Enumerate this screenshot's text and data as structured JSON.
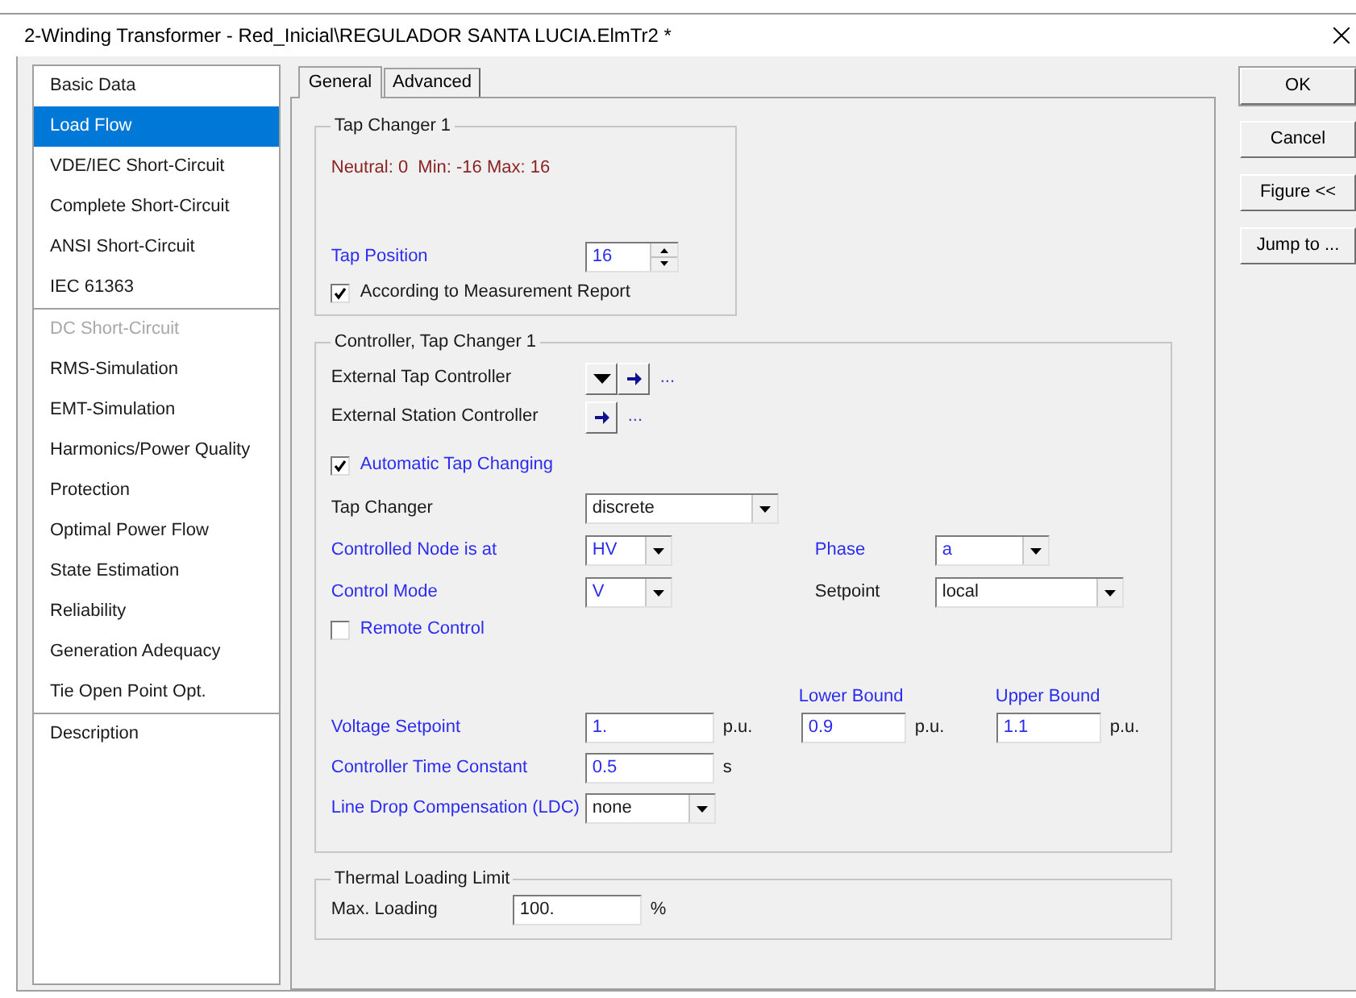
{
  "window": {
    "title": "2-Winding Transformer - Red_Inicial\\REGULADOR SANTA LUCIA.ElmTr2 *"
  },
  "sidebar": {
    "groups": [
      {
        "items": [
          {
            "label": "Basic Data",
            "selected": false,
            "disabled": false
          },
          {
            "label": "Load Flow",
            "selected": true,
            "disabled": false
          },
          {
            "label": "VDE/IEC Short-Circuit",
            "selected": false,
            "disabled": false
          },
          {
            "label": "Complete Short-Circuit",
            "selected": false,
            "disabled": false
          },
          {
            "label": "ANSI Short-Circuit",
            "selected": false,
            "disabled": false
          },
          {
            "label": "IEC 61363",
            "selected": false,
            "disabled": false
          }
        ]
      },
      {
        "items": [
          {
            "label": "DC Short-Circuit",
            "selected": false,
            "disabled": true
          },
          {
            "label": "RMS-Simulation",
            "selected": false,
            "disabled": false
          },
          {
            "label": "EMT-Simulation",
            "selected": false,
            "disabled": false
          },
          {
            "label": "Harmonics/Power Quality",
            "selected": false,
            "disabled": false
          },
          {
            "label": "Protection",
            "selected": false,
            "disabled": false
          },
          {
            "label": "Optimal Power Flow",
            "selected": false,
            "disabled": false
          },
          {
            "label": "State Estimation",
            "selected": false,
            "disabled": false
          },
          {
            "label": "Reliability",
            "selected": false,
            "disabled": false
          },
          {
            "label": "Generation Adequacy",
            "selected": false,
            "disabled": false
          },
          {
            "label": "Tie Open Point Opt.",
            "selected": false,
            "disabled": false
          }
        ]
      },
      {
        "items": [
          {
            "label": "Description",
            "selected": false,
            "disabled": false
          }
        ]
      }
    ]
  },
  "tabs": [
    {
      "label": "General",
      "selected": true
    },
    {
      "label": "Advanced",
      "selected": false
    }
  ],
  "tap_changer": {
    "title": "Tap Changer 1",
    "range_info": "Neutral: 0  Min: -16 Max: 16",
    "tap_position": {
      "label": "Tap Position",
      "value": "16",
      "highlighted": true,
      "value_highlighted": true
    },
    "measurement_report": {
      "label": "According to Measurement Report",
      "checked": true,
      "highlighted": false
    }
  },
  "controller": {
    "title": "Controller, Tap Changer 1",
    "external_tap_controller": {
      "label": "External Tap Controller",
      "link": "..."
    },
    "external_station_controller": {
      "label": "External Station Controller",
      "link": "..."
    },
    "automatic_tap_changing": {
      "label": "Automatic Tap Changing",
      "checked": true,
      "highlighted": true
    },
    "tap_changer": {
      "label": "Tap Changer",
      "value": "discrete",
      "highlighted": false,
      "value_highlighted": false
    },
    "controlled_node": {
      "label": "Controlled Node is at",
      "value": "HV",
      "highlighted": true,
      "value_highlighted": true
    },
    "phase": {
      "label": "Phase",
      "value": "a",
      "highlighted": true,
      "value_highlighted": true
    },
    "control_mode": {
      "label": "Control Mode",
      "value": "V",
      "highlighted": true,
      "value_highlighted": true
    },
    "setpoint": {
      "label": "Setpoint",
      "value": "local",
      "highlighted": false,
      "value_highlighted": false
    },
    "remote_control": {
      "label": "Remote Control",
      "checked": false,
      "highlighted": true
    },
    "voltage_setpoint": {
      "label": "Voltage Setpoint",
      "value": "1.",
      "unit": "p.u.",
      "highlighted": true,
      "value_highlighted": true
    },
    "lower_bound": {
      "label": "Lower Bound",
      "value": "0.9",
      "unit": "p.u.",
      "highlighted": true,
      "value_highlighted": true
    },
    "upper_bound": {
      "label": "Upper Bound",
      "value": "1.1",
      "unit": "p.u.",
      "highlighted": true,
      "value_highlighted": true
    },
    "time_constant": {
      "label": "Controller Time Constant",
      "value": "0.5",
      "unit": "s",
      "highlighted": true,
      "value_highlighted": true
    },
    "ldc": {
      "label": "Line Drop Compensation (LDC)",
      "value": "none",
      "highlighted": true,
      "value_highlighted": false
    }
  },
  "thermal": {
    "title": "Thermal Loading Limit",
    "max_loading": {
      "label": "Max. Loading",
      "value": "100.",
      "unit": "%",
      "highlighted": false,
      "value_highlighted": false
    }
  },
  "buttons": [
    "OK",
    "Cancel",
    "Figure <<",
    "Jump to ..."
  ]
}
